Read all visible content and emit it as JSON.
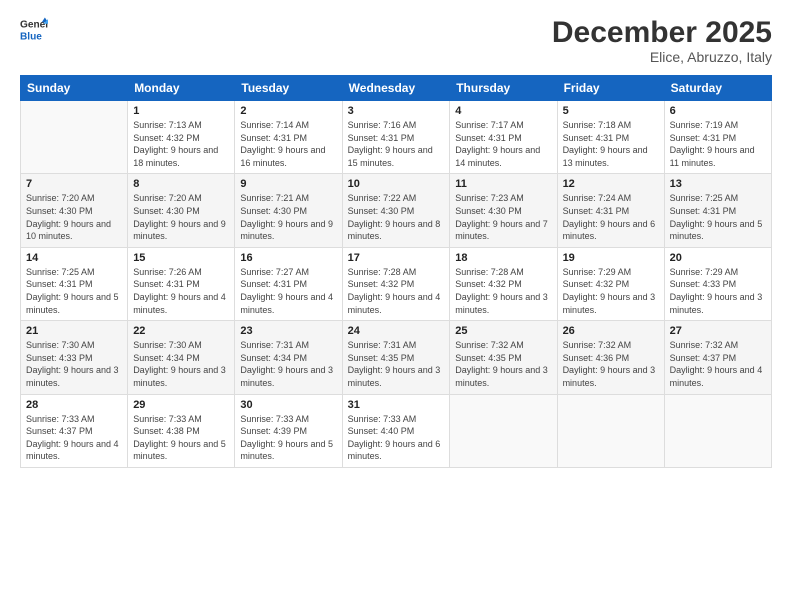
{
  "header": {
    "logo_line1": "General",
    "logo_line2": "Blue",
    "month": "December 2025",
    "location": "Elice, Abruzzo, Italy"
  },
  "days_of_week": [
    "Sunday",
    "Monday",
    "Tuesday",
    "Wednesday",
    "Thursday",
    "Friday",
    "Saturday"
  ],
  "weeks": [
    [
      {
        "day": "",
        "sunrise": "",
        "sunset": "",
        "daylight": ""
      },
      {
        "day": "1",
        "sunrise": "Sunrise: 7:13 AM",
        "sunset": "Sunset: 4:32 PM",
        "daylight": "Daylight: 9 hours and 18 minutes."
      },
      {
        "day": "2",
        "sunrise": "Sunrise: 7:14 AM",
        "sunset": "Sunset: 4:31 PM",
        "daylight": "Daylight: 9 hours and 16 minutes."
      },
      {
        "day": "3",
        "sunrise": "Sunrise: 7:16 AM",
        "sunset": "Sunset: 4:31 PM",
        "daylight": "Daylight: 9 hours and 15 minutes."
      },
      {
        "day": "4",
        "sunrise": "Sunrise: 7:17 AM",
        "sunset": "Sunset: 4:31 PM",
        "daylight": "Daylight: 9 hours and 14 minutes."
      },
      {
        "day": "5",
        "sunrise": "Sunrise: 7:18 AM",
        "sunset": "Sunset: 4:31 PM",
        "daylight": "Daylight: 9 hours and 13 minutes."
      },
      {
        "day": "6",
        "sunrise": "Sunrise: 7:19 AM",
        "sunset": "Sunset: 4:31 PM",
        "daylight": "Daylight: 9 hours and 11 minutes."
      }
    ],
    [
      {
        "day": "7",
        "sunrise": "Sunrise: 7:20 AM",
        "sunset": "Sunset: 4:30 PM",
        "daylight": "Daylight: 9 hours and 10 minutes."
      },
      {
        "day": "8",
        "sunrise": "Sunrise: 7:20 AM",
        "sunset": "Sunset: 4:30 PM",
        "daylight": "Daylight: 9 hours and 9 minutes."
      },
      {
        "day": "9",
        "sunrise": "Sunrise: 7:21 AM",
        "sunset": "Sunset: 4:30 PM",
        "daylight": "Daylight: 9 hours and 9 minutes."
      },
      {
        "day": "10",
        "sunrise": "Sunrise: 7:22 AM",
        "sunset": "Sunset: 4:30 PM",
        "daylight": "Daylight: 9 hours and 8 minutes."
      },
      {
        "day": "11",
        "sunrise": "Sunrise: 7:23 AM",
        "sunset": "Sunset: 4:30 PM",
        "daylight": "Daylight: 9 hours and 7 minutes."
      },
      {
        "day": "12",
        "sunrise": "Sunrise: 7:24 AM",
        "sunset": "Sunset: 4:31 PM",
        "daylight": "Daylight: 9 hours and 6 minutes."
      },
      {
        "day": "13",
        "sunrise": "Sunrise: 7:25 AM",
        "sunset": "Sunset: 4:31 PM",
        "daylight": "Daylight: 9 hours and 5 minutes."
      }
    ],
    [
      {
        "day": "14",
        "sunrise": "Sunrise: 7:25 AM",
        "sunset": "Sunset: 4:31 PM",
        "daylight": "Daylight: 9 hours and 5 minutes."
      },
      {
        "day": "15",
        "sunrise": "Sunrise: 7:26 AM",
        "sunset": "Sunset: 4:31 PM",
        "daylight": "Daylight: 9 hours and 4 minutes."
      },
      {
        "day": "16",
        "sunrise": "Sunrise: 7:27 AM",
        "sunset": "Sunset: 4:31 PM",
        "daylight": "Daylight: 9 hours and 4 minutes."
      },
      {
        "day": "17",
        "sunrise": "Sunrise: 7:28 AM",
        "sunset": "Sunset: 4:32 PM",
        "daylight": "Daylight: 9 hours and 4 minutes."
      },
      {
        "day": "18",
        "sunrise": "Sunrise: 7:28 AM",
        "sunset": "Sunset: 4:32 PM",
        "daylight": "Daylight: 9 hours and 3 minutes."
      },
      {
        "day": "19",
        "sunrise": "Sunrise: 7:29 AM",
        "sunset": "Sunset: 4:32 PM",
        "daylight": "Daylight: 9 hours and 3 minutes."
      },
      {
        "day": "20",
        "sunrise": "Sunrise: 7:29 AM",
        "sunset": "Sunset: 4:33 PM",
        "daylight": "Daylight: 9 hours and 3 minutes."
      }
    ],
    [
      {
        "day": "21",
        "sunrise": "Sunrise: 7:30 AM",
        "sunset": "Sunset: 4:33 PM",
        "daylight": "Daylight: 9 hours and 3 minutes."
      },
      {
        "day": "22",
        "sunrise": "Sunrise: 7:30 AM",
        "sunset": "Sunset: 4:34 PM",
        "daylight": "Daylight: 9 hours and 3 minutes."
      },
      {
        "day": "23",
        "sunrise": "Sunrise: 7:31 AM",
        "sunset": "Sunset: 4:34 PM",
        "daylight": "Daylight: 9 hours and 3 minutes."
      },
      {
        "day": "24",
        "sunrise": "Sunrise: 7:31 AM",
        "sunset": "Sunset: 4:35 PM",
        "daylight": "Daylight: 9 hours and 3 minutes."
      },
      {
        "day": "25",
        "sunrise": "Sunrise: 7:32 AM",
        "sunset": "Sunset: 4:35 PM",
        "daylight": "Daylight: 9 hours and 3 minutes."
      },
      {
        "day": "26",
        "sunrise": "Sunrise: 7:32 AM",
        "sunset": "Sunset: 4:36 PM",
        "daylight": "Daylight: 9 hours and 3 minutes."
      },
      {
        "day": "27",
        "sunrise": "Sunrise: 7:32 AM",
        "sunset": "Sunset: 4:37 PM",
        "daylight": "Daylight: 9 hours and 4 minutes."
      }
    ],
    [
      {
        "day": "28",
        "sunrise": "Sunrise: 7:33 AM",
        "sunset": "Sunset: 4:37 PM",
        "daylight": "Daylight: 9 hours and 4 minutes."
      },
      {
        "day": "29",
        "sunrise": "Sunrise: 7:33 AM",
        "sunset": "Sunset: 4:38 PM",
        "daylight": "Daylight: 9 hours and 5 minutes."
      },
      {
        "day": "30",
        "sunrise": "Sunrise: 7:33 AM",
        "sunset": "Sunset: 4:39 PM",
        "daylight": "Daylight: 9 hours and 5 minutes."
      },
      {
        "day": "31",
        "sunrise": "Sunrise: 7:33 AM",
        "sunset": "Sunset: 4:40 PM",
        "daylight": "Daylight: 9 hours and 6 minutes."
      },
      {
        "day": "",
        "sunrise": "",
        "sunset": "",
        "daylight": ""
      },
      {
        "day": "",
        "sunrise": "",
        "sunset": "",
        "daylight": ""
      },
      {
        "day": "",
        "sunrise": "",
        "sunset": "",
        "daylight": ""
      }
    ]
  ]
}
